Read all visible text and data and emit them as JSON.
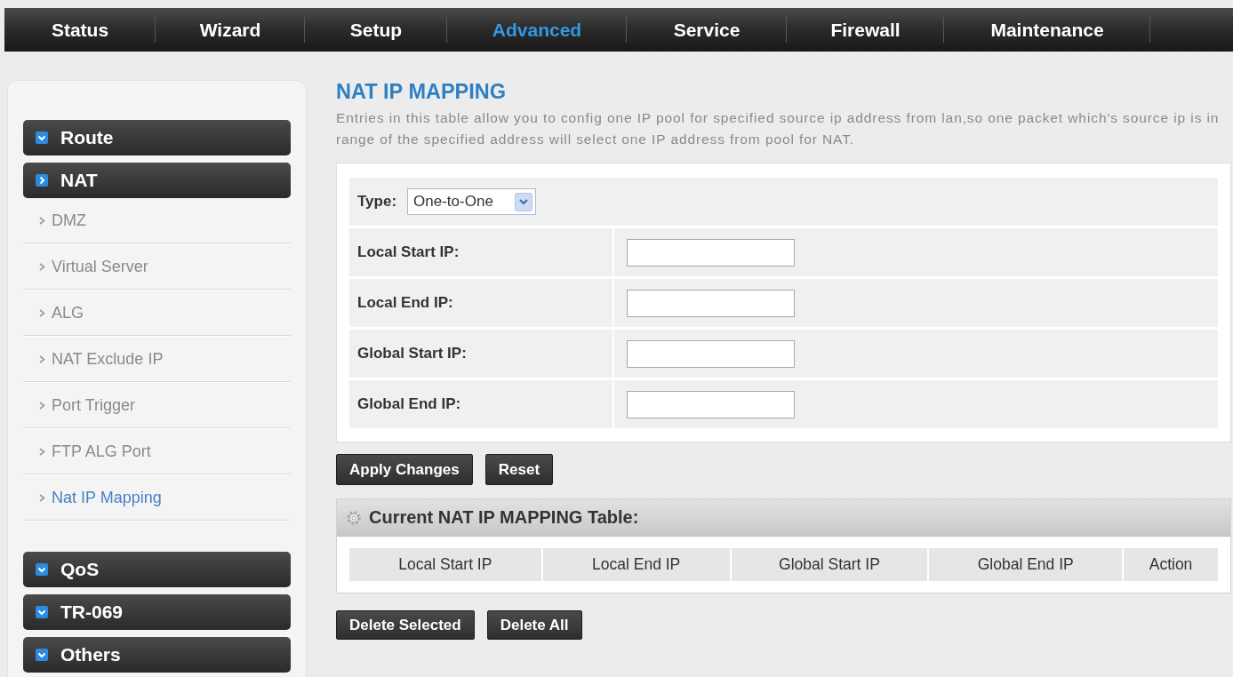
{
  "nav": {
    "tabs": [
      {
        "label": "Status",
        "selected": false
      },
      {
        "label": "Wizard",
        "selected": false
      },
      {
        "label": "Setup",
        "selected": false
      },
      {
        "label": "Advanced",
        "selected": true
      },
      {
        "label": "Service",
        "selected": false
      },
      {
        "label": "Firewall",
        "selected": false
      },
      {
        "label": "Maintenance",
        "selected": false
      }
    ]
  },
  "sidebar": {
    "sections": [
      {
        "label": "Route",
        "selected": false
      },
      {
        "label": "NAT",
        "selected": true,
        "children": [
          {
            "label": "DMZ",
            "selected": false
          },
          {
            "label": "Virtual Server",
            "selected": false
          },
          {
            "label": "ALG",
            "selected": false
          },
          {
            "label": "NAT Exclude IP",
            "selected": false
          },
          {
            "label": "Port Trigger",
            "selected": false
          },
          {
            "label": "FTP ALG Port",
            "selected": false
          },
          {
            "label": "Nat IP Mapping",
            "selected": true
          }
        ]
      },
      {
        "label": "QoS",
        "selected": false
      },
      {
        "label": "TR-069",
        "selected": false
      },
      {
        "label": "Others",
        "selected": false
      }
    ]
  },
  "page": {
    "title": "NAT IP MAPPING",
    "description": "Entries in this table allow you to config one IP pool for specified source ip address from lan,so one packet which's source ip is in range of the specified address will select one IP address from pool for NAT."
  },
  "form": {
    "type": {
      "label": "Type:",
      "value": "One-to-One"
    },
    "fields": [
      {
        "label": "Local Start IP:"
      },
      {
        "label": "Local End IP:"
      },
      {
        "label": "Global Start IP:"
      },
      {
        "label": "Global End IP:"
      }
    ]
  },
  "form_buttons": [
    "Apply Changes",
    "Reset"
  ],
  "table": {
    "title": "Current NAT IP MAPPING Table:",
    "columns": [
      "Local Start IP",
      "Local End IP",
      "Global Start IP",
      "Global End IP",
      "Action"
    ]
  },
  "table_buttons": [
    "Delete Selected",
    "Delete All"
  ]
}
